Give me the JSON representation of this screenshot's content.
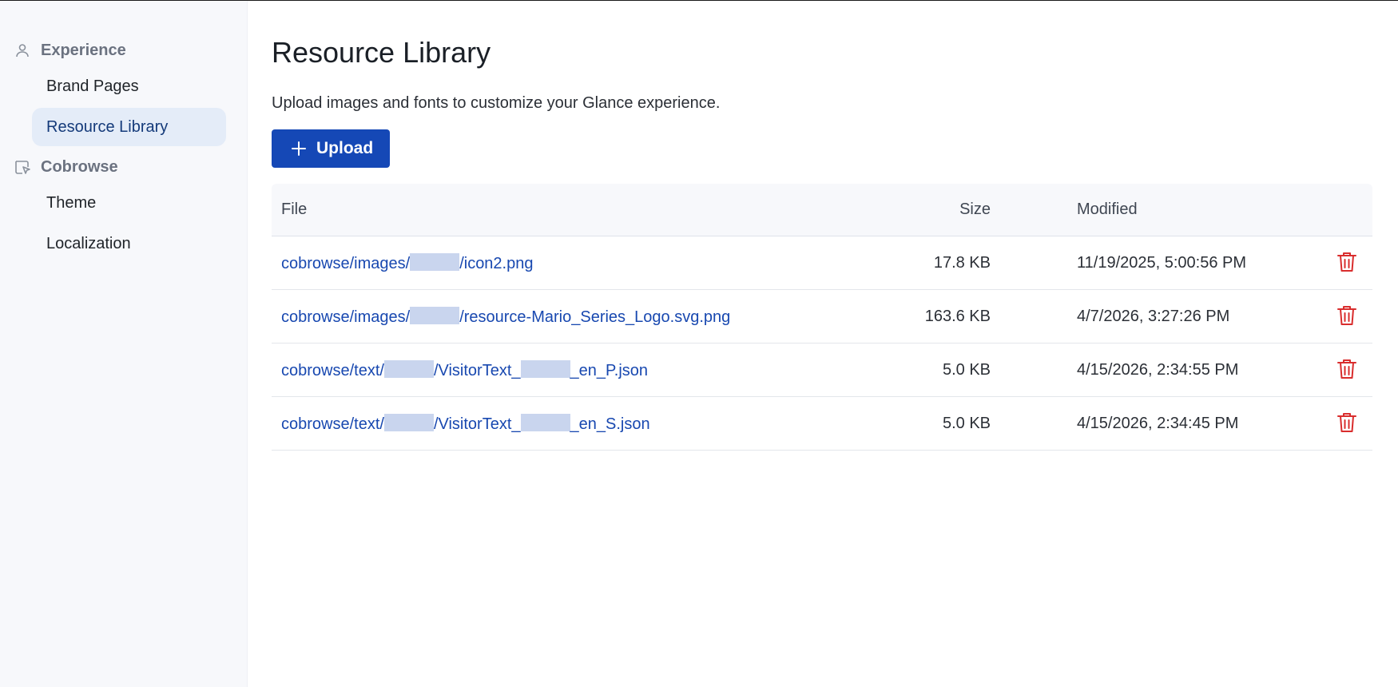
{
  "sidebar": {
    "sections": [
      {
        "label": "Experience",
        "icon": "person-icon",
        "items": [
          {
            "label": "Brand Pages",
            "active": false
          },
          {
            "label": "Resource Library",
            "active": true
          }
        ]
      },
      {
        "label": "Cobrowse",
        "icon": "cobrowse-icon",
        "items": [
          {
            "label": "Theme",
            "active": false
          },
          {
            "label": "Localization",
            "active": false
          }
        ]
      }
    ]
  },
  "main": {
    "title": "Resource Library",
    "description": "Upload images and fonts to customize your Glance experience.",
    "upload_label": "Upload",
    "table": {
      "headers": {
        "file": "File",
        "size": "Size",
        "modified": "Modified"
      },
      "rows": [
        {
          "file_prefix": "cobrowse/images/",
          "file_mid": "",
          "file_suffix": "/icon2.png",
          "size": "17.8 KB",
          "modified": "11/19/2025, 5:00:56 PM"
        },
        {
          "file_prefix": "cobrowse/images/",
          "file_mid": "",
          "file_suffix": "/resource-Mario_Series_Logo.svg.png",
          "size": "163.6 KB",
          "modified": "4/7/2026, 3:27:26 PM"
        },
        {
          "file_prefix": "cobrowse/text/",
          "file_mid": "/VisitorText_",
          "file_suffix": "_en_P.json",
          "size": "5.0 KB",
          "modified": "4/15/2026, 2:34:55 PM"
        },
        {
          "file_prefix": "cobrowse/text/",
          "file_mid": "/VisitorText_",
          "file_suffix": "_en_S.json",
          "size": "5.0 KB",
          "modified": "4/15/2026, 2:34:45 PM"
        }
      ]
    }
  },
  "colors": {
    "accent": "#1548b6",
    "link": "#1848b0",
    "danger": "#d92d2d",
    "sidebar_bg": "#f7f8fb",
    "active_item_bg": "#e4ecf8"
  }
}
